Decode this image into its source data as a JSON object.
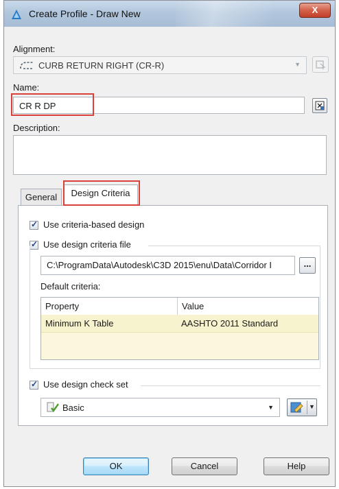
{
  "window": {
    "title": "Create Profile - Draw New",
    "close_label": "X"
  },
  "alignment": {
    "label": "Alignment:",
    "value": "CURB RETURN RIGHT (CR-R)"
  },
  "name": {
    "label": "Name:",
    "value": "CR R DP"
  },
  "description": {
    "label": "Description:",
    "value": ""
  },
  "tabs": [
    {
      "label": "General",
      "active": false
    },
    {
      "label": "Design Criteria",
      "active": true
    }
  ],
  "design_criteria": {
    "use_criteria_label": "Use criteria-based design",
    "use_criteria_checked": true,
    "use_file_label": "Use design criteria file",
    "use_file_checked": true,
    "file_path": "C:\\ProgramData\\Autodesk\\C3D 2015\\enu\\Data\\Corridor I",
    "browse_label": "...",
    "default_criteria_label": "Default criteria:",
    "columns": [
      "Property",
      "Value"
    ],
    "rows": [
      {
        "property": "Minimum K Table",
        "value": "AASHTO 2011 Standard"
      }
    ],
    "use_check_set_label": "Use design check set",
    "use_check_set_checked": true,
    "check_set_value": "Basic"
  },
  "buttons": {
    "ok": "OK",
    "cancel": "Cancel",
    "help": "Help"
  },
  "colors": {
    "highlight": "#d9403a",
    "grid_row": "#f7f3cf",
    "title_bar": "#b2c7dd"
  }
}
